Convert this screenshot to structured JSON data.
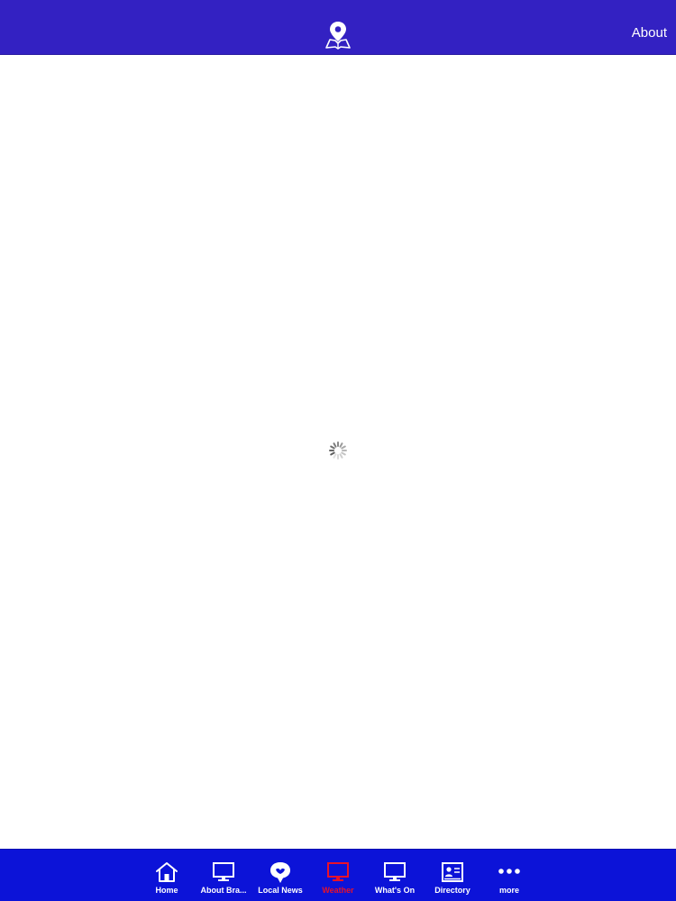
{
  "header": {
    "about_label": "About",
    "logo_icon": "map-pin-icon",
    "bar_color": "#3321c2"
  },
  "content": {
    "state_icon": "loading-spinner-icon"
  },
  "tab_bar": {
    "bar_color": "#0c13d8",
    "active_color": "#e8122a",
    "tabs": [
      {
        "label": "Home",
        "icon": "home-icon",
        "active": false
      },
      {
        "label": "About Bra...",
        "icon": "monitor-icon",
        "active": false
      },
      {
        "label": "Local News",
        "icon": "speech-bubble-icon",
        "active": false
      },
      {
        "label": "Weather",
        "icon": "monitor-icon",
        "active": true
      },
      {
        "label": "What's On",
        "icon": "monitor-icon",
        "active": false
      },
      {
        "label": "Directory",
        "icon": "contact-card-icon",
        "active": false
      },
      {
        "label": "more",
        "icon": "more-dots-icon",
        "active": false
      }
    ]
  }
}
